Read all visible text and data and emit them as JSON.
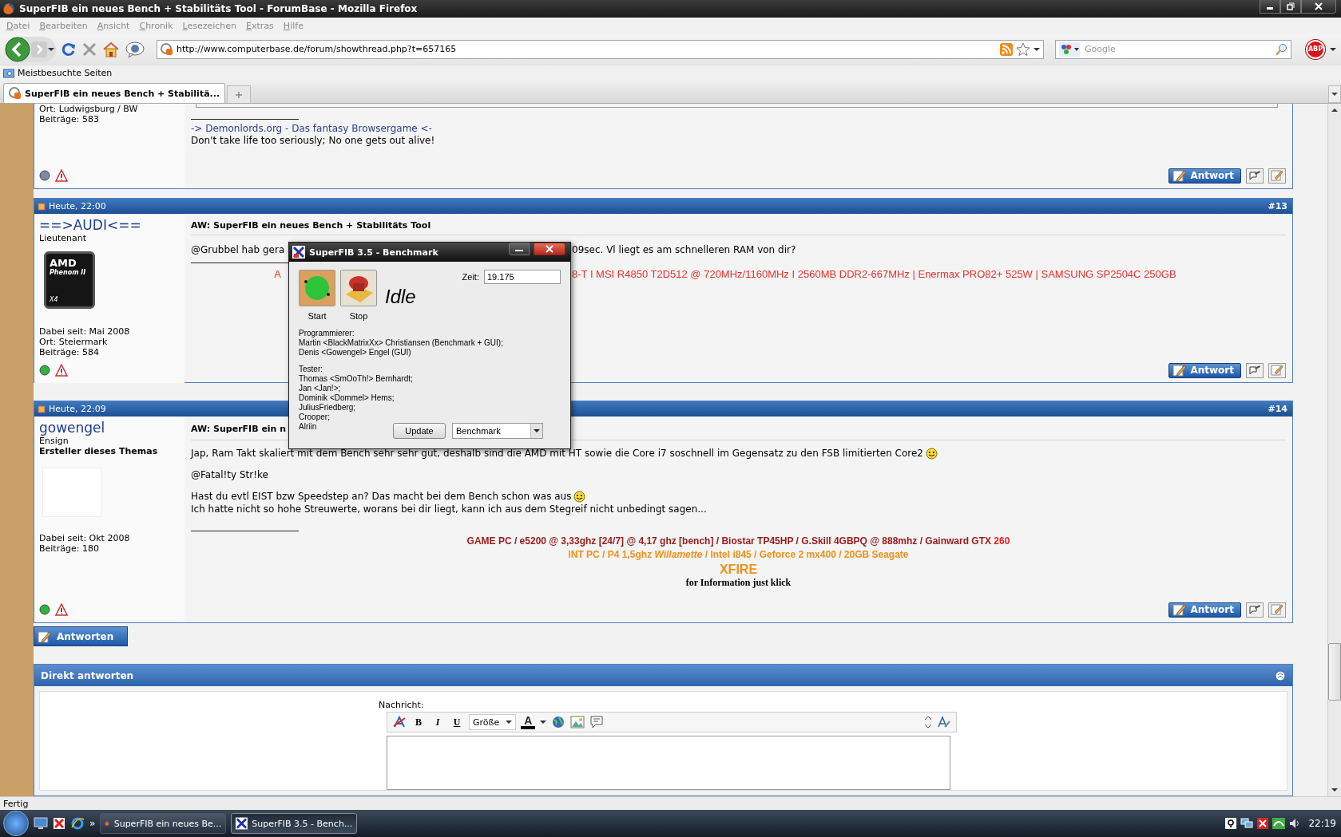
{
  "window": {
    "title": "SuperFIB ein neues Bench + Stabilitäts Tool - ForumBase - Mozilla Firefox"
  },
  "menu": [
    "Datei",
    "Bearbeiten",
    "Ansicht",
    "Chronik",
    "Lesezeichen",
    "Extras",
    "Hilfe"
  ],
  "address": {
    "url": "http://www.computerbase.de/forum/showthread.php?t=657165"
  },
  "search": {
    "placeholder": "Google"
  },
  "addon": {
    "label": "ABP"
  },
  "bookmarks": [
    "Meistbesuchte Seiten"
  ],
  "tabs": [
    {
      "label": "SuperFIB ein neues Bench + Stabilitä...",
      "selected": true
    }
  ],
  "posts": [
    {
      "user": {
        "details": [
          "Ort: Ludwigsburg / BW",
          "Beiträge: 583"
        ]
      },
      "online": false,
      "reply": "Antwort",
      "body": [
        {
          "kind": "quote"
        },
        {
          "kind": "rule"
        },
        {
          "kind": "link",
          "text": "-> Demonlords.org - Das fantasy Browsergame <-"
        },
        {
          "kind": "paragraph",
          "lines": [
            {
              "text": "Don't take life too seriously; No one gets out alive!",
              "smiley": false
            }
          ]
        }
      ]
    },
    {
      "header": {
        "date": "Heute, 22:00",
        "number": "#13"
      },
      "user": {
        "name": "==>AUDI<==",
        "rank": "Lieutenant",
        "avatar": {
          "kind": "logo",
          "brand": "AMD",
          "model": "Phenom II",
          "cores": "X4"
        },
        "details": [
          "Dabei seit: Mai 2008",
          "Ort: Steiermark",
          "Beiträge: 584"
        ]
      },
      "online": true,
      "reply": "Antwort",
      "body": [
        {
          "kind": "title",
          "text": "AW: SuperFIB ein neues Bench + Stabilitäts Tool"
        },
        {
          "kind": "split",
          "parts": [
            "@Grubbel hab gera",
            "09sec. Vl liegt es am schnelleren RAM von dir?"
          ]
        },
        {
          "kind": "rule"
        },
        {
          "kind": "split",
          "color": "#e8322c",
          "parts": [
            "A",
            "8-T I MSI R4850 T2D512 @ 720MHz/1160MHz I 2560MB DDR2-667MHz | Enermax PRO82+ 525W | SAMSUNG SP2504C 250GB"
          ]
        }
      ]
    },
    {
      "header": {
        "date": "Heute, 22:09",
        "number": "#14"
      },
      "user": {
        "name": "gowengel",
        "rank": "Ensign",
        "role": "Ersteller dieses Themas",
        "avatar": {
          "kind": "picture"
        },
        "details": [
          "Dabei seit: Okt 2008",
          "Beiträge: 180"
        ]
      },
      "online": true,
      "reply": "Antwort",
      "body": [
        {
          "kind": "split_title",
          "parts": [
            "AW: SuperFIB ein n"
          ]
        },
        {
          "kind": "paragraph",
          "lines": [
            {
              "text": "Jap, Ram Takt skaliert mit dem Bench sehr sehr gut, deshalb sind die AMD mit HT sowie die Core i7 soschnell im Gegensatz zu den FSB limitierten Core2",
              "smiley": true
            }
          ]
        },
        {
          "kind": "paragraph",
          "lines": [
            {
              "text": "@Fatal!ty Str!ke",
              "smiley": false
            }
          ]
        },
        {
          "kind": "paragraph",
          "lines": [
            {
              "text": "Hast du evtl EIST bzw Speedstep an? Das macht bei dem Bench schon was aus",
              "smiley": true
            },
            {
              "text": "Ich hatte nicht so hohe Streuwerte, worans bei dir liegt, kann ich aus dem Stegreif nicht unbedingt sagen...",
              "smiley": false
            }
          ]
        },
        {
          "kind": "rule"
        },
        {
          "kind": "sig",
          "segments": [
            {
              "text": "GAME PC / e5200 @ 3,33ghz [24/7] @ 4,17 ghz [bench] / Biostar TP45HP / G.Skill 4GBPQ @ 888mhz / Gainward GTX ",
              "color": "#9a1a1a"
            },
            {
              "text": "260",
              "color": "#e8202a"
            }
          ]
        },
        {
          "kind": "sig",
          "segments": [
            {
              "text": "INT PC / P4 1,5ghz *Willamette* / Intel i845 / Geforce 2 mx400 / 20GB Seagate",
              "color": "#f0901a"
            }
          ]
        },
        {
          "kind": "sig_heading",
          "segments": [
            {
              "text": "XFIRE",
              "color": "#f0901a"
            }
          ]
        },
        {
          "kind": "sig_note",
          "segments": [
            {
              "text": "for Information just klick",
              "color": "#000000"
            }
          ]
        }
      ]
    }
  ],
  "reply_button": "Antworten",
  "quick_reply": {
    "title": "Direkt antworten",
    "label": "Nachricht:",
    "format_buttons": [
      "B",
      "I",
      "U"
    ],
    "size_dropdown": "Größe",
    "color_button": "A"
  },
  "dialog": {
    "title": "SuperFIB 3.5 - Benchmark",
    "start": "Start",
    "stop": "Stop",
    "status": "Idle",
    "time_label": "Zeit:",
    "time_value": "19.175",
    "credits": [
      {
        "lines": [
          "Programmierer:",
          "Martin <BlackMatrixXx> Christiansen (Benchmark + GUI);",
          "Denis <Gowengel> Engel (GUI)"
        ]
      },
      {
        "lines": [
          "Tester:",
          "Thomas <SmOoTh!> Bernhardt;",
          "Jan <Jan!>;",
          "Dominik <Dommel> Hems;",
          "JuliusFriedberg;",
          "Crooper;",
          "Alriin"
        ]
      }
    ],
    "update": "Update",
    "mode": "Benchmark"
  },
  "status_bar": "Fertig",
  "taskbar": {
    "overflow": "»",
    "tasks": [
      {
        "label": "SuperFIB ein neues Be...",
        "selected": false
      },
      {
        "label": "SuperFIB 3.5 - Bench...",
        "selected": true
      }
    ],
    "clock": "22:19"
  }
}
